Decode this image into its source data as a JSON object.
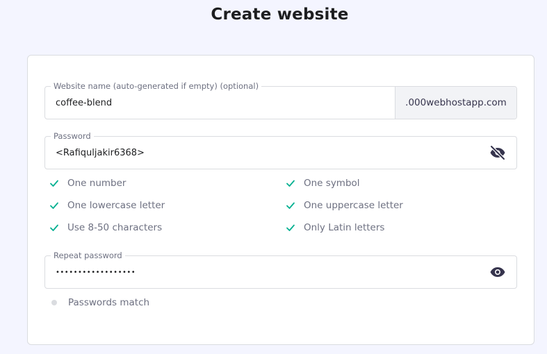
{
  "page": {
    "title": "Create website"
  },
  "website_name": {
    "label": "Website name (auto-generated if empty) (optional)",
    "value": "coffee-blend",
    "suffix": ".000webhostapp.com"
  },
  "password": {
    "label": "Password",
    "value": "<Rafiquljakir6368>",
    "toggle_icon": "eye-off-icon"
  },
  "requirements": {
    "left": [
      "One number",
      "One lowercase letter",
      "Use 8-50 characters"
    ],
    "right": [
      "One symbol",
      "One uppercase letter",
      "Only Latin letters"
    ],
    "check_icon": "check-icon",
    "check_color": "#00b090"
  },
  "repeat_password": {
    "label": "Repeat password",
    "value": "••••••••••••••••••",
    "toggle_icon": "eye-icon"
  },
  "match": {
    "label": "Passwords match",
    "status_color": "#dadce0"
  },
  "colors": {
    "background": "#f4f5ff",
    "card": "#ffffff",
    "border": "#dadce0",
    "text": "#1d1e20",
    "muted": "#6d7081"
  }
}
